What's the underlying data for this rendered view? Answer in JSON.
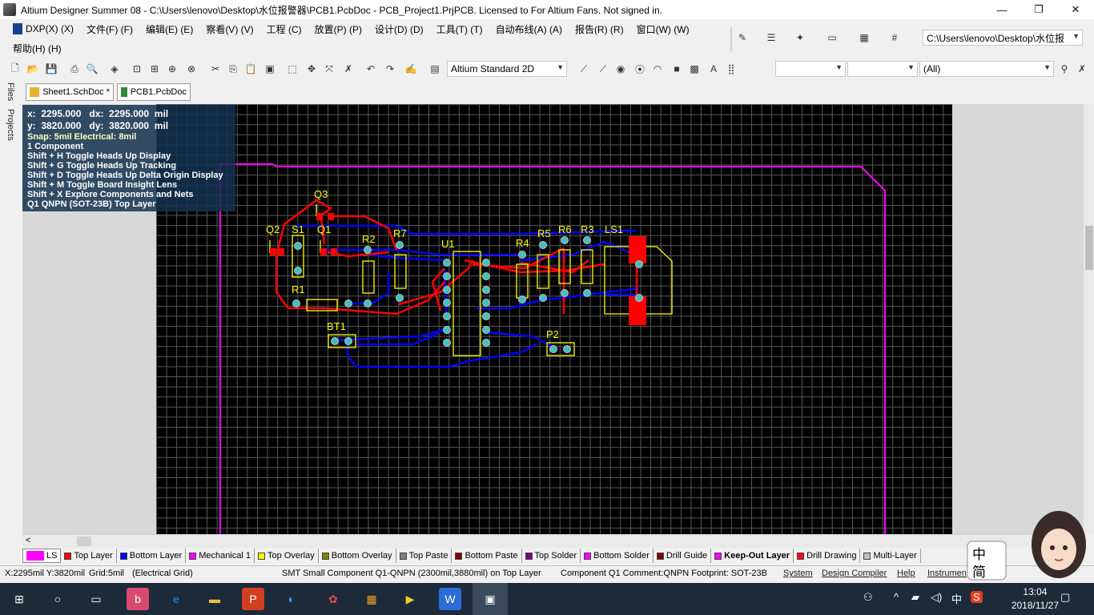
{
  "titlebar": {
    "title": "Altium Designer Summer 08 - C:\\Users\\lenovo\\Desktop\\水位报警器\\PCB1.PcbDoc - PCB_Project1.PrjPCB. Licensed to For Altium Fans. Not signed in.",
    "minimize": "—",
    "maximize": "❐",
    "close": "✕"
  },
  "menu": {
    "row1": [
      "DXP(X) (X)",
      "文件(F) (F)",
      "编辑(E) (E)",
      "察看(V) (V)",
      "工程 (C)",
      "放置(P) (P)",
      "设计(D) (D)",
      "工具(T) (T)",
      "自动布线(A) (A)",
      "报告(R) (R)",
      "窗口(W) (W)"
    ],
    "row2": [
      "帮助(H) (H)"
    ]
  },
  "toolbar": {
    "path_combo": "C:\\Users\\lenovo\\Desktop\\水位报",
    "view_combo": "Altium Standard 2D",
    "combo_a": "",
    "combo_b": "",
    "filter_combo": "(All)"
  },
  "side_tabs": [
    "Files",
    "Projects"
  ],
  "doc_tabs": [
    {
      "label": "Sheet1.SchDoc *"
    },
    {
      "label": "PCB1.PcbDoc"
    }
  ],
  "hud": {
    "x_line": "x:  2295.000   dx:  2295.000  mil",
    "y_line": "y:  3820.000   dy:  3820.000  mil",
    "snap": "Snap: 5mil Electrical: 8mil",
    "count": "1 Component",
    "hints": [
      "Shift + H   Toggle Heads Up Display",
      "Shift + G   Toggle Heads Up Tracking",
      "Shift + D   Toggle Heads Up Delta Origin Display",
      "Shift + M  Toggle Board Insight Lens",
      "Shift + X   Explore Components and Nets"
    ],
    "component": "Q1  QNPN (SOT-23B)  Top Layer"
  },
  "designators": [
    "Q3",
    "Q2",
    "S1",
    "Q1",
    "R2",
    "R7",
    "U1",
    "R4",
    "R5",
    "R6",
    "R3",
    "LS1",
    "R1",
    "BT1",
    "P2"
  ],
  "layers": {
    "current": "LS",
    "tabs": [
      {
        "label": "Top Layer",
        "color": "#ff0000"
      },
      {
        "label": "Bottom Layer",
        "color": "#0000ff"
      },
      {
        "label": "Mechanical 1",
        "color": "#ff00ff"
      },
      {
        "label": "Top Overlay",
        "color": "#ffff00"
      },
      {
        "label": "Bottom Overlay",
        "color": "#808000"
      },
      {
        "label": "Top Paste",
        "color": "#808080"
      },
      {
        "label": "Bottom Paste",
        "color": "#800000"
      },
      {
        "label": "Top Solder",
        "color": "#800080"
      },
      {
        "label": "Bottom Solder",
        "color": "#ff00ff"
      },
      {
        "label": "Drill Guide",
        "color": "#800000"
      },
      {
        "label": "Keep-Out Layer",
        "color": "#ff00ff"
      },
      {
        "label": "Drill Drawing",
        "color": "#ff002a"
      },
      {
        "label": "Multi-Layer",
        "color": "#c0c0c0"
      }
    ]
  },
  "status": {
    "coords": "X:2295mil Y:3820mil",
    "grid": "Grid:5mil",
    "mode": "(Electrical Grid)",
    "message": "SMT Small Component Q1-QNPN (2300mil,3880mil) on Top Layer",
    "component": "Component Q1 Comment:QNPN Footprint: SOT-23B",
    "buttons": [
      "System",
      "Design Compiler",
      "Help",
      "Instrumen"
    ]
  },
  "taskbar": {
    "ime_char": "中",
    "time": "13:04",
    "date": "2018/11/27"
  },
  "ime_widget": {
    "top": "中",
    "bottom": "简"
  }
}
